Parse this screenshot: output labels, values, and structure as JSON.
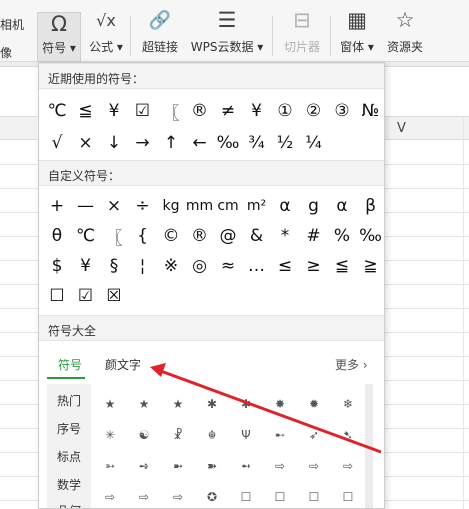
{
  "toolbar": {
    "partial_top": "相机",
    "partial_bottom": "像",
    "buttons": [
      {
        "id": "symbol",
        "icon": "Ω",
        "label": "符号 ▾"
      },
      {
        "id": "formula",
        "icon": "√x",
        "label": "公式 ▾"
      },
      {
        "id": "hyperlink",
        "icon": "🔗",
        "label": "超链接"
      },
      {
        "id": "wps_data",
        "icon": "☰",
        "label": "WPS云数据 ▾"
      },
      {
        "id": "slicer",
        "icon": "⊟",
        "label": "切片器"
      },
      {
        "id": "window",
        "icon": "▦",
        "label": "窗体 ▾"
      },
      {
        "id": "resources",
        "icon": "☆",
        "label": "资源夹"
      }
    ]
  },
  "sheet": {
    "column_label": "V"
  },
  "panel": {
    "recent": {
      "title": "近期使用的符号：",
      "rows": [
        [
          "℃",
          "≦",
          "¥",
          "☑",
          "〖",
          "®",
          "≠",
          "¥",
          "①",
          "②",
          "③",
          "№"
        ],
        [
          "√",
          "×",
          "↓",
          "→",
          "↑",
          "←",
          "‰",
          "¾",
          "½",
          "¼"
        ]
      ]
    },
    "custom": {
      "title": "自定义符号：",
      "rows": [
        [
          "+",
          "—",
          "×",
          "÷",
          "kg",
          "mm",
          "cm",
          "m²",
          "α",
          "g",
          "α",
          "β"
        ],
        [
          "θ",
          "℃",
          "〖",
          "{",
          "©",
          "®",
          "@",
          "&",
          "*",
          "#",
          "%",
          "‰"
        ],
        [
          "$",
          "¥",
          "§",
          "¦",
          "※",
          "◎",
          "≈",
          "…",
          "≤",
          "≥",
          "≦",
          "≧"
        ],
        [
          "☐",
          "☑",
          "☒"
        ]
      ]
    },
    "all": {
      "title": "符号大全",
      "tabs": [
        "符号",
        "颜文字"
      ],
      "more": "更多 ›",
      "categories": [
        "热门",
        "序号",
        "标点",
        "数学",
        "几何"
      ],
      "grid": [
        [
          "★",
          "★",
          "★",
          "✱",
          "✱",
          "✸",
          "✹",
          "❄"
        ],
        [
          "✳",
          "☯",
          "☧",
          "☬",
          "Ψ",
          "➸",
          "➶",
          "➷"
        ],
        [
          "➳",
          "➺",
          "➼",
          "➽",
          "➻",
          "⇨",
          "⇨",
          "⇨"
        ],
        [
          "⇨",
          "⇨",
          "⇨",
          "✪",
          "☐",
          "☐",
          "☐",
          "☐"
        ]
      ]
    }
  },
  "colors": {
    "accent": "#2a9a3c",
    "arrow": "#e0222a"
  }
}
